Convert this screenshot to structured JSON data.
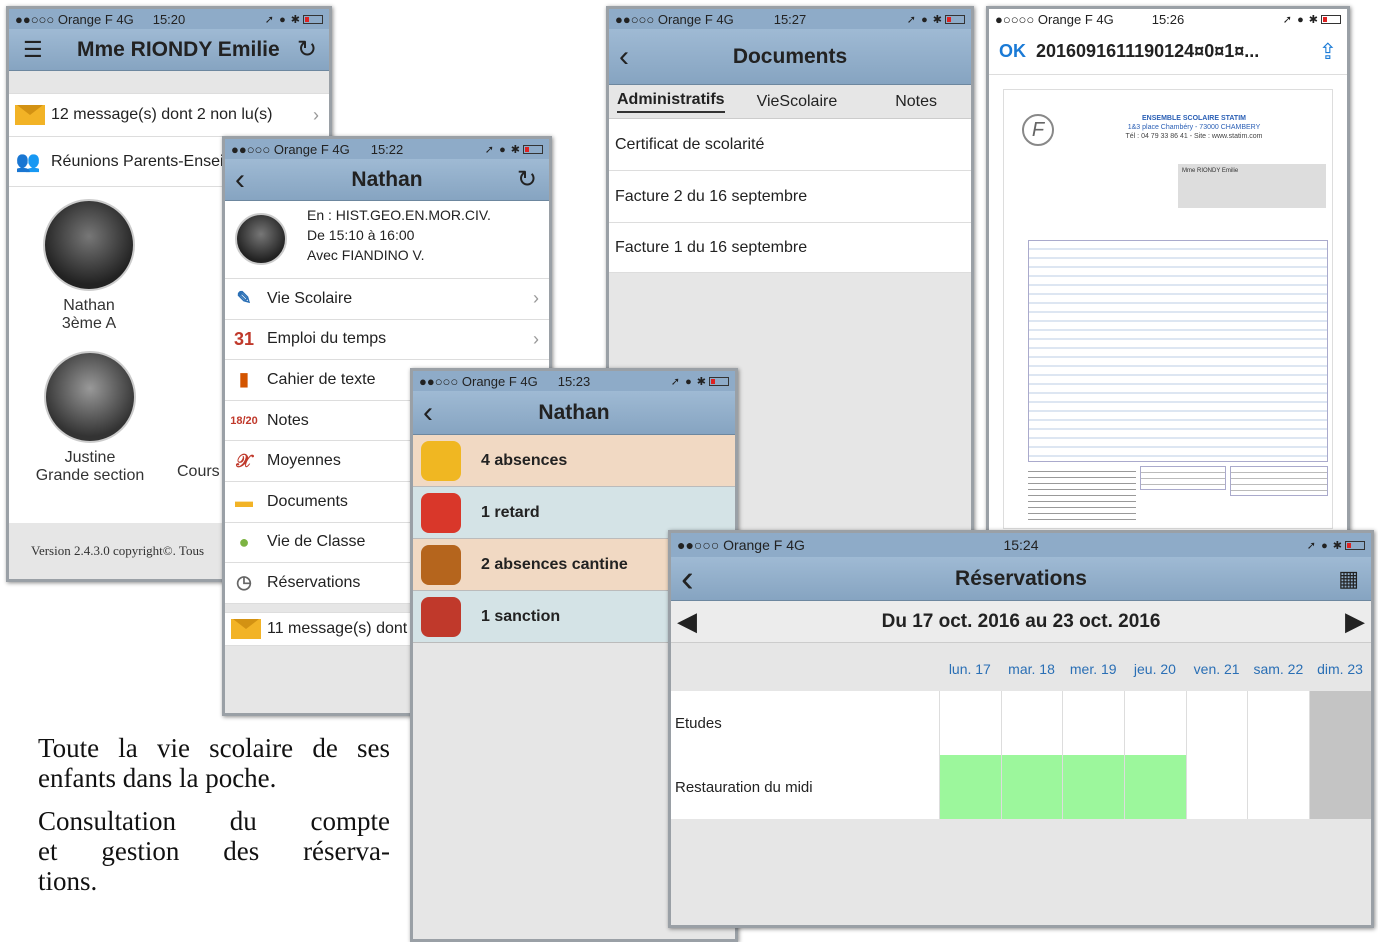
{
  "phone1": {
    "carrier": "●●○○○ Orange F  4G",
    "time": "15:20",
    "title": "Mme RIONDY Emilie",
    "rows": [
      "12 message(s) dont 2 non lu(s)",
      "Réunions Parents-Enseignants"
    ],
    "children": [
      {
        "name": "Nathan",
        "class": "3ème A"
      },
      {
        "name": "Justine",
        "class": "Grande section"
      }
    ],
    "cut_label": "Cours",
    "footer": "Version 2.4.3.0 copyright©. Tous"
  },
  "phone2": {
    "carrier": "●●○○○ Orange F  4G",
    "time": "15:22",
    "title": "Nathan",
    "course": [
      "En : HIST.GEO.EN.MOR.CIV.",
      "De 15:10 à 16:00",
      "Avec FIANDINO V."
    ],
    "menu": [
      {
        "label": "Vie Scolaire",
        "icon": "✎",
        "color": "#2a6fb5"
      },
      {
        "label": "Emploi du temps",
        "icon": "31",
        "color": "#c0392b"
      },
      {
        "label": "Cahier de texte",
        "icon": "▮",
        "color": "#d35400"
      },
      {
        "label": "Notes",
        "icon": "18/20",
        "color": "#c0392b"
      },
      {
        "label": "Moyennes",
        "icon": "𝒳",
        "color": "#c0392b"
      },
      {
        "label": "Documents",
        "icon": "▬",
        "color": "#f2b326"
      },
      {
        "label": "Vie de Classe",
        "icon": "●",
        "color": "#7cb342"
      },
      {
        "label": "Réservations",
        "icon": "◷",
        "color": "#666"
      }
    ],
    "message": "11 message(s) dont"
  },
  "phone3": {
    "carrier": "●●○○○ Orange F  4G",
    "time": "15:27",
    "title": "Documents",
    "tabs": [
      "Administratifs",
      "VieScolaire",
      "Notes"
    ],
    "docs": [
      "Certificat de scolarité",
      "Facture 2 du 16 septembre",
      "Facture 1 du 16 septembre"
    ]
  },
  "phone4": {
    "carrier": "●○○○○ Orange F  4G",
    "time": "15:26",
    "ok": "OK",
    "title": "2016091611190124¤0¤1¤...",
    "doc_school": "ENSEMBLE SCOLAIRE STATIM",
    "doc_address": "1&3 place Chambéry - 73000 CHAMBERY",
    "doc_contact": "Tél : 04 79 33 86 41 - Site : www.statim.com",
    "doc_recipient": "Mme RIONDY Emilie",
    "doc_logo": "F"
  },
  "phone5": {
    "carrier": "●●○○○ Orange F  4G",
    "time": "15:23",
    "title": "Nathan",
    "items": [
      {
        "label": "4 absences",
        "bg": "#f1d9c3",
        "icon_color": "#f0b722"
      },
      {
        "label": "1 retard",
        "bg": "#d4e3e6",
        "icon_color": "#d9372a"
      },
      {
        "label": "2 absences cantine",
        "bg": "#f1d9c3",
        "icon_color": "#b5651d"
      },
      {
        "label": "1 sanction",
        "bg": "#d4e3e6",
        "icon_color": "#c0392b"
      }
    ]
  },
  "phone6": {
    "carrier": "●●○○○ Orange F  4G",
    "time": "15:24",
    "title": "Réservations",
    "week": "Du 17 oct. 2016 au 23 oct. 2016",
    "days": [
      "lun. 17",
      "mar. 18",
      "mer. 19",
      "jeu. 20",
      "ven. 21",
      "sam. 22",
      "dim. 23"
    ],
    "rows": [
      {
        "label": "Etudes",
        "cells": [
          "w",
          "w",
          "w",
          "w",
          "w",
          "w",
          "g"
        ]
      },
      {
        "label": "Restauration du midi",
        "cells": [
          "r",
          "r",
          "r",
          "r",
          "w",
          "w",
          "g"
        ]
      }
    ]
  },
  "caption": {
    "line1": "Toute la vie scolaire de ses",
    "line2": "enfants dans la poche.",
    "line3": "Consultation du compte",
    "line4": "et gestion des réserva-",
    "line5": "tions."
  },
  "colors": {
    "reserved": "#9cf79c",
    "weekend": "#c4c4c4",
    "link_blue": "#1a7ad6"
  }
}
